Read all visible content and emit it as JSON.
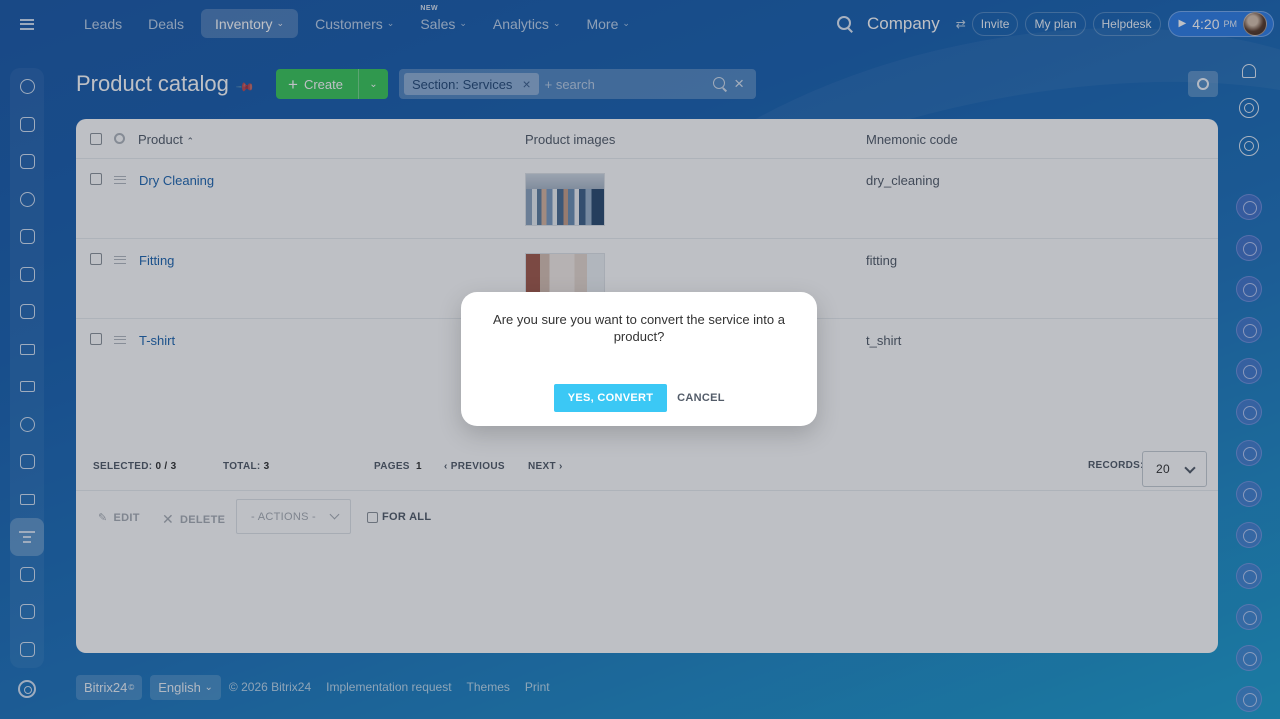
{
  "topnav": {
    "items": [
      {
        "label": "Leads",
        "chevron": false,
        "new": ""
      },
      {
        "label": "Deals",
        "chevron": false,
        "new": ""
      },
      {
        "label": "Inventory",
        "chevron": true,
        "new": "",
        "active": true
      },
      {
        "label": "Customers",
        "chevron": true,
        "new": ""
      },
      {
        "label": "Sales",
        "chevron": true,
        "new": "NEW"
      },
      {
        "label": "Analytics",
        "chevron": true,
        "new": ""
      },
      {
        "label": "More",
        "chevron": true,
        "new": ""
      }
    ],
    "company": "Company",
    "invite": "Invite",
    "my_plan": "My plan",
    "helpdesk": "Helpdesk",
    "clock_time": "4:20",
    "clock_ampm": "PM"
  },
  "page": {
    "title": "Product catalog",
    "create_label": "Create",
    "filter_chip": "Section: Services",
    "search_placeholder": "+ search"
  },
  "table": {
    "columns": {
      "product": "Product",
      "images": "Product images",
      "code": "Mnemonic code"
    },
    "rows": [
      {
        "name": "Dry Cleaning",
        "code": "dry_cleaning"
      },
      {
        "name": "Fitting",
        "code": "fitting"
      },
      {
        "name": "T-shirt",
        "code": "t_shirt"
      }
    ],
    "footer": {
      "selected_label": "SELECTED:",
      "selected_value": "0 / 3",
      "total_label": "TOTAL:",
      "total_value": "3",
      "pages_label": "PAGES",
      "pages_value": "1",
      "previous": "PREVIOUS",
      "next": "NEXT",
      "records_label": "RECORDS:",
      "records_value": "20"
    },
    "actions": {
      "edit": "EDIT",
      "delete": "DELETE",
      "actions_select": "- ACTIONS -",
      "for_all": "FOR ALL"
    }
  },
  "footer": {
    "brand": "Bitrix24",
    "brand_mark": "©",
    "language": "English",
    "copyright": "© 2026 Bitrix24",
    "links": [
      "Implementation request",
      "Themes",
      "Print"
    ]
  },
  "dialog": {
    "message": "Are you sure you want to convert the service into a product?",
    "confirm": "YES, CONVERT",
    "cancel": "CANCEL"
  },
  "colors": {
    "accent_green": "#3bc85b",
    "confirm_blue": "#3bc8f5",
    "link_blue": "#2067b0"
  }
}
